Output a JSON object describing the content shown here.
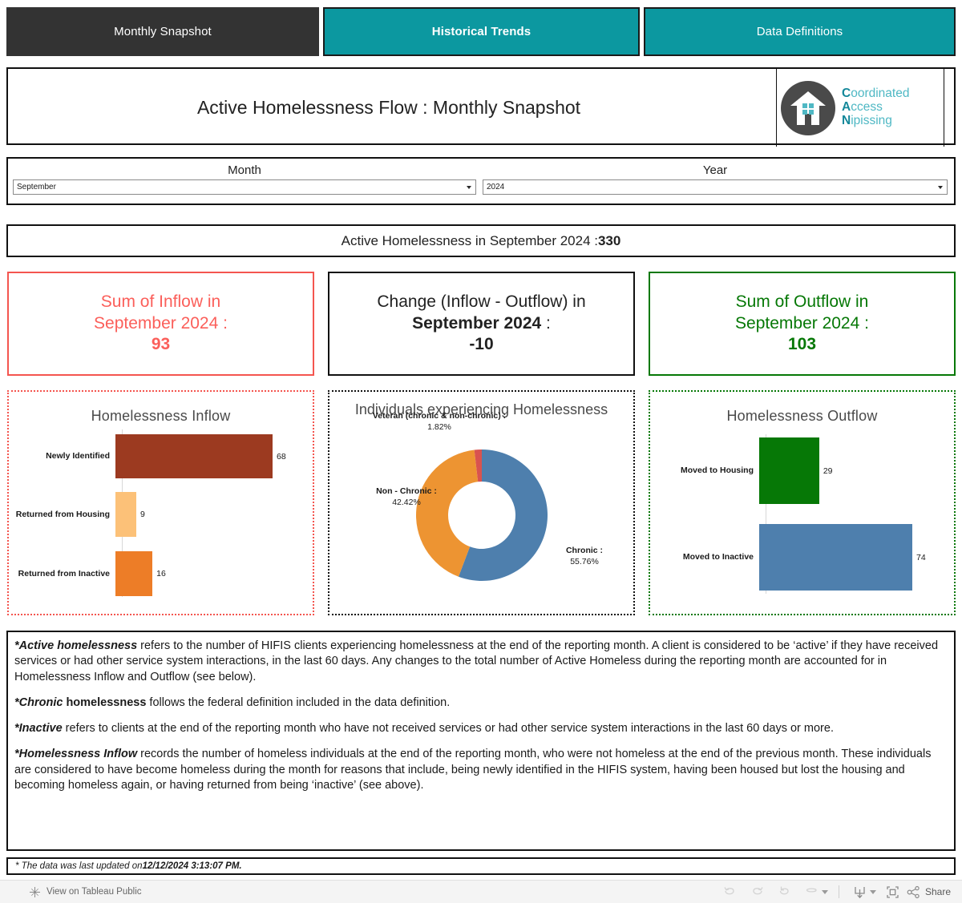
{
  "tabs": [
    {
      "label": "Monthly Snapshot",
      "active": false
    },
    {
      "label": "Historical Trends",
      "active": true
    },
    {
      "label": "Data Definitions",
      "active": false
    }
  ],
  "header": {
    "title": "Active Homelessness Flow : Monthly Snapshot",
    "logo": {
      "line1_cap": "C",
      "line1_rest": "oordinated",
      "line2_cap": "A",
      "line2_rest": "ccess",
      "line3_cap": "N",
      "line3_rest": "ipissing",
      "circle_color": "#4a4a4a",
      "text_color": "#4fb8c4"
    }
  },
  "filters": {
    "month": {
      "label": "Month",
      "value": "September"
    },
    "year": {
      "label": "Year",
      "value": "2024"
    }
  },
  "banner": {
    "prefix": "Active Homelessness in September 2024 : ",
    "value": "330"
  },
  "kpi": {
    "inflow": {
      "line1": "Sum of Inflow in",
      "line2": "September 2024 :",
      "value": "93",
      "color": "#fb5f5a"
    },
    "change": {
      "line1": "Change (Inflow - Outflow) in",
      "line2": "September 2024",
      "line2_suffix": " :",
      "value": "-10",
      "color": "#222222"
    },
    "outflow": {
      "line1": "Sum of Outflow in",
      "line2": "September 2024 :",
      "value": "103",
      "color": "#067806"
    }
  },
  "chart_data": [
    {
      "type": "bar",
      "title": "Homelessness Inflow",
      "orientation": "horizontal",
      "categories": [
        "Newly Identified",
        "Returned from Housing",
        "Returned from Inactive"
      ],
      "values": [
        68,
        9,
        16
      ],
      "colors": [
        "#9c3a20",
        "#fcc178",
        "#ed7d27"
      ],
      "xlabel": "",
      "ylabel": "",
      "xlim": [
        0,
        68
      ],
      "grid": false,
      "legend": "none"
    },
    {
      "type": "pie",
      "subtype": "donut",
      "title": "Individuals experiencing Homelessness",
      "title_clipped": true,
      "slices": [
        {
          "label": "Chronic :",
          "percent": "55.76%",
          "value": 55.76,
          "color": "#4e7fad"
        },
        {
          "label": "Non - Chronic :",
          "percent": "42.42%",
          "value": 42.42,
          "color": "#ed9432"
        },
        {
          "label": "Veteran (chronic & non-chronic) :",
          "percent": "1.82%",
          "value": 1.82,
          "color": "#d9534f"
        }
      ],
      "legend": "labels-outside"
    },
    {
      "type": "bar",
      "title": "Homelessness Outflow",
      "orientation": "horizontal",
      "categories": [
        "Moved to Housing",
        "Moved to Inactive"
      ],
      "values": [
        29,
        74
      ],
      "colors": [
        "#067806",
        "#4e7fad"
      ],
      "xlabel": "",
      "ylabel": "",
      "xlim": [
        0,
        74
      ],
      "grid": false,
      "legend": "none"
    }
  ],
  "definitions": [
    {
      "lead": "*Active homelessness",
      "rest": " refers to the number of HIFIS clients experiencing homelessness at the end of the reporting month. A client is considered to be ‘active’ if they have received services or had other service system interactions, in the last 60 days. Any changes to the total number of Active Homeless during the reporting month are accounted for in Homelessness Inflow and Outflow (see below)."
    },
    {
      "lead": "*Chronic",
      "lead_bold": " homelessness",
      "rest": " follows the federal definition included in the data definition."
    },
    {
      "lead": "*Inactive",
      "rest": " refers to clients at the end of the reporting month who have not received services or had other service system interactions in the last 60 days or more."
    },
    {
      "lead": "*Homelessness Inflow",
      "rest": " records the number of homeless individuals at the end of the reporting month, who were not homeless at the end of the previous month. These individuals are considered to have become homeless during the month for reasons that include, being newly identified in the HIFIS system, having been housed but lost the housing and becoming homeless again, or having returned from being ‘inactive’ (see above)."
    }
  ],
  "updated": {
    "prefix": "* The data was last updated on ",
    "timestamp": "12/12/2024 3:13:07 PM."
  },
  "footer": {
    "view_label": "View on Tableau Public",
    "share_label": "Share"
  }
}
